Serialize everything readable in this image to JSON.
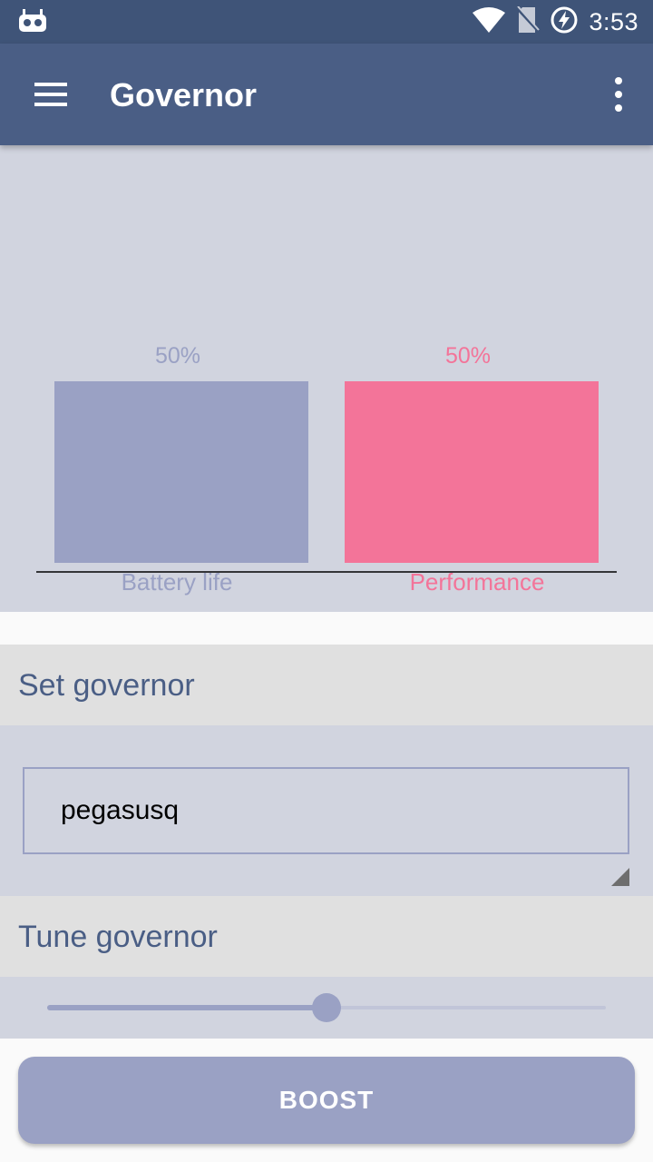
{
  "status_bar": {
    "time": "3:53",
    "icons": [
      "bot-icon",
      "wifi-icon",
      "no-sim-icon",
      "battery-charging-icon"
    ]
  },
  "app_bar": {
    "title": "Governor",
    "menu_icon": "hamburger-menu-icon",
    "more_icon": "more-vertical-icon"
  },
  "chart_data": {
    "type": "bar",
    "categories": [
      "Battery life",
      "Performance"
    ],
    "values": [
      50,
      50
    ],
    "value_labels": [
      "50%",
      "50%"
    ],
    "colors": [
      "#9aa1c4",
      "#f37499"
    ],
    "ylim": [
      0,
      100
    ]
  },
  "set_governor": {
    "header": "Set governor",
    "value": "pegasusq"
  },
  "tune_governor": {
    "header": "Tune governor",
    "slider_value": 0.5
  },
  "boost_button": {
    "label": "BOOST"
  },
  "colors": {
    "status_bar": "#3f5478",
    "app_bar": "#4a5e85",
    "panel": "#d1d4df",
    "header_bg": "#e0e0e0",
    "accent": "#9aa1c4",
    "pink": "#f37499"
  }
}
